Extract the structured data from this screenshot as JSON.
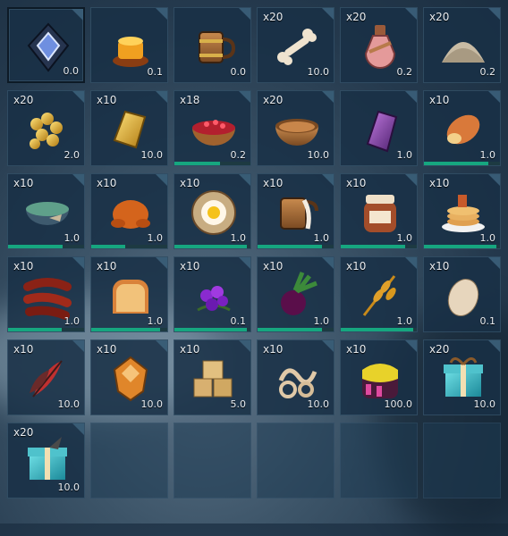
{
  "inventory": {
    "slots": [
      {
        "qty": "",
        "weight": "0.0",
        "icon": "crystal-gem-icon",
        "selected": true
      },
      {
        "qty": "",
        "weight": "0.1",
        "icon": "honey-candle-icon"
      },
      {
        "qty": "",
        "weight": "0.0",
        "icon": "wooden-mug-icon"
      },
      {
        "qty": "x20",
        "weight": "10.0",
        "icon": "bone-icon"
      },
      {
        "qty": "x20",
        "weight": "0.2",
        "icon": "potion-bottle-icon"
      },
      {
        "qty": "x20",
        "weight": "0.2",
        "icon": "sand-pile-icon"
      },
      {
        "qty": "x20",
        "weight": "2.0",
        "icon": "coins-icon"
      },
      {
        "qty": "x10",
        "weight": "10.0",
        "icon": "gold-ingot-icon"
      },
      {
        "qty": "x18",
        "weight": "0.2",
        "icon": "berry-bowl-icon",
        "freshness": 0.6
      },
      {
        "qty": "x20",
        "weight": "10.0",
        "icon": "wooden-bowl-icon"
      },
      {
        "qty": "",
        "weight": "1.0",
        "icon": "purple-ingot-icon"
      },
      {
        "qty": "x10",
        "weight": "1.0",
        "icon": "bread-loaf-icon",
        "freshness": 0.85
      },
      {
        "qty": "x10",
        "weight": "1.0",
        "icon": "fish-soup-icon",
        "freshness": 0.72
      },
      {
        "qty": "x10",
        "weight": "1.0",
        "icon": "roast-chicken-icon",
        "freshness": 0.45
      },
      {
        "qty": "x10",
        "weight": "1.0",
        "icon": "fried-egg-plate-icon",
        "freshness": 0.95
      },
      {
        "qty": "x10",
        "weight": "1.0",
        "icon": "milk-mug-icon",
        "freshness": 0.85
      },
      {
        "qty": "x10",
        "weight": "1.0",
        "icon": "jam-jar-icon",
        "freshness": 0.85
      },
      {
        "qty": "x10",
        "weight": "1.0",
        "icon": "pancakes-icon",
        "freshness": 0.95
      },
      {
        "qty": "x10",
        "weight": "1.0",
        "icon": "sausages-icon",
        "freshness": 0.7
      },
      {
        "qty": "x10",
        "weight": "1.0",
        "icon": "bread-slice-icon",
        "freshness": 0.9
      },
      {
        "qty": "x10",
        "weight": "0.1",
        "icon": "purple-berries-icon",
        "freshness": 0.95
      },
      {
        "qty": "x10",
        "weight": "1.0",
        "icon": "beetroot-icon",
        "freshness": 0.85
      },
      {
        "qty": "x10",
        "weight": "1.0",
        "icon": "wheat-icon",
        "freshness": 0.95
      },
      {
        "qty": "x10",
        "weight": "0.1",
        "icon": "egg-icon"
      },
      {
        "qty": "x10",
        "weight": "10.0",
        "icon": "feathers-icon"
      },
      {
        "qty": "x10",
        "weight": "10.0",
        "icon": "amber-crystal-icon"
      },
      {
        "qty": "x10",
        "weight": "5.0",
        "icon": "wood-blocks-icon"
      },
      {
        "qty": "x10",
        "weight": "10.0",
        "icon": "rope-coil-icon"
      },
      {
        "qty": "x10",
        "weight": "100.0",
        "icon": "gold-ore-icon"
      },
      {
        "qty": "x20",
        "weight": "10.0",
        "icon": "gift-box-icon"
      },
      {
        "qty": "x20",
        "weight": "10.0",
        "icon": "gift-box-feather-icon"
      },
      {
        "empty": true
      },
      {
        "empty": true
      },
      {
        "empty": true
      },
      {
        "empty": true
      },
      {
        "empty": true
      }
    ]
  }
}
